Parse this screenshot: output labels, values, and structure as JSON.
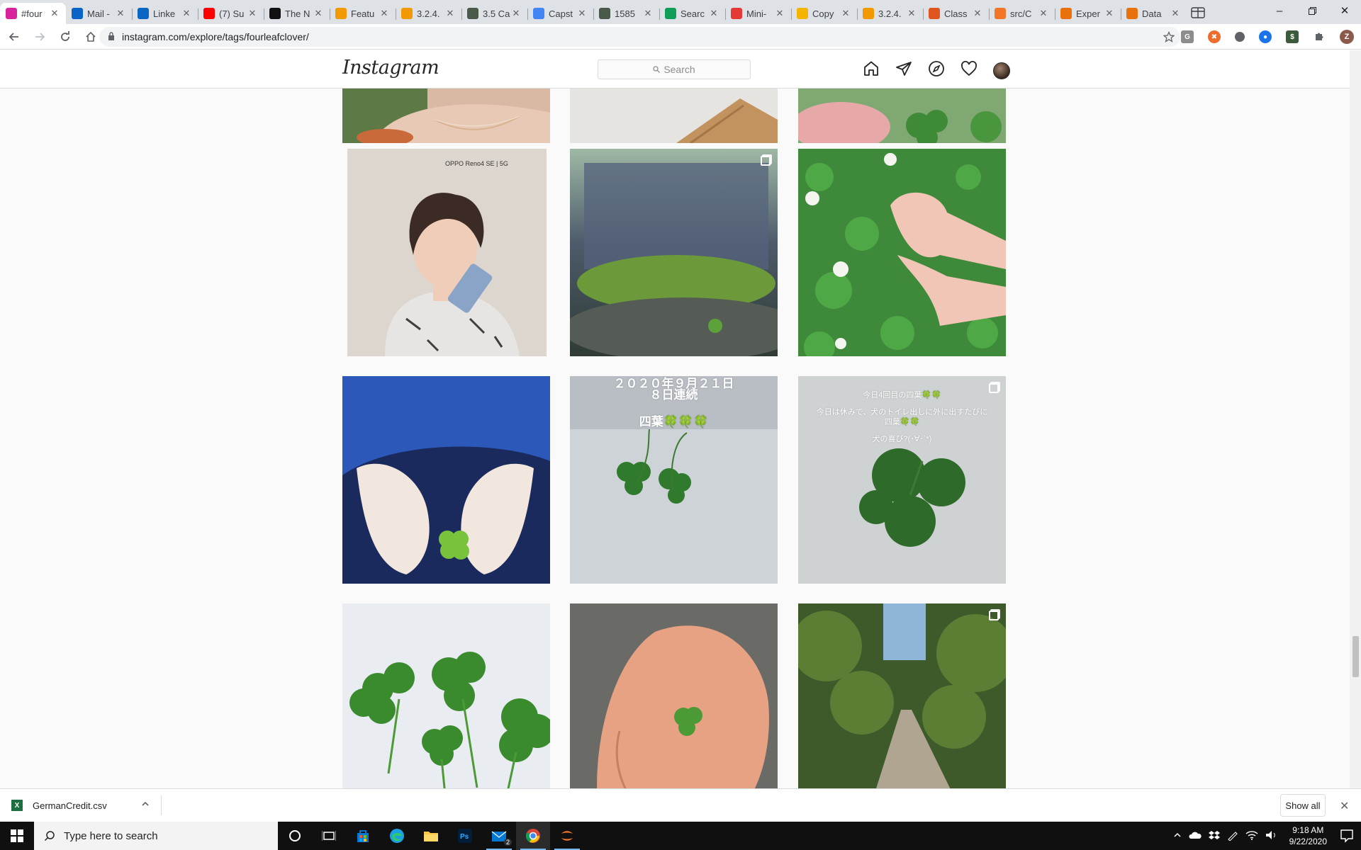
{
  "browser": {
    "tabs": [
      {
        "title": "#four",
        "icon": "instagram-icon",
        "color": "#d6249f"
      },
      {
        "title": "Mail -",
        "icon": "outlook-icon",
        "color": "#0a64c8"
      },
      {
        "title": "Linke",
        "icon": "linkedin-icon",
        "color": "#0a66c2"
      },
      {
        "title": "(7) Su",
        "icon": "youtube-icon",
        "color": "#ff0000"
      },
      {
        "title": "The N",
        "icon": "nyt-icon",
        "color": "#111111"
      },
      {
        "title": "Featu",
        "icon": "chart-icon",
        "color": "#f29900"
      },
      {
        "title": "3.2.4.",
        "icon": "chart-icon",
        "color": "#f29900"
      },
      {
        "title": "3.5 Ca",
        "icon": "doc-icon",
        "color": "#4a5a4a"
      },
      {
        "title": "Capst",
        "icon": "docs-icon",
        "color": "#4285f4"
      },
      {
        "title": "1585",
        "icon": "doc-icon",
        "color": "#4a5a4a"
      },
      {
        "title": "Searc",
        "icon": "drive-icon",
        "color": "#0f9d58"
      },
      {
        "title": "Mini-",
        "icon": "link-icon",
        "color": "#e53935"
      },
      {
        "title": "Copy",
        "icon": "copy-icon",
        "color": "#f4b400"
      },
      {
        "title": "3.2.4.",
        "icon": "chart-icon",
        "color": "#f29900"
      },
      {
        "title": "Class",
        "icon": "notebook-icon",
        "color": "#e0541d"
      },
      {
        "title": "src/C",
        "icon": "jupyter-icon",
        "color": "#f37626"
      },
      {
        "title": "Exper",
        "icon": "book-icon",
        "color": "#e8710a"
      },
      {
        "title": "Data",
        "icon": "book-icon",
        "color": "#e8710a"
      }
    ],
    "url": "instagram.com/explore/tags/fourleafclover/",
    "profile_initial": "Z"
  },
  "instagram": {
    "logo": "Instagram",
    "search_placeholder": "Search",
    "posts": [
      {
        "name": "post-bracelet-partial"
      },
      {
        "name": "post-wood-partial"
      },
      {
        "name": "post-clover-partial"
      },
      {
        "name": "post-oppo-portrait",
        "text_lines": [
          "OPPO Reno4 SE | 5G"
        ]
      },
      {
        "name": "post-mossy-rock"
      },
      {
        "name": "post-heart-hands"
      },
      {
        "name": "post-cupped-hands"
      },
      {
        "name": "post-clover-table",
        "text_lines": [
          "２０２０年９月２１日",
          "８日連続",
          "四葉🍀🍀🍀"
        ]
      },
      {
        "name": "post-clover-dog",
        "text_lines": [
          "今日4回目の四葉🍀🍀",
          "今日は休みで、犬のトイレ出しに外に出すたびに",
          "四葉🍀🍀",
          "犬の喜び?(･∀･`*)"
        ]
      },
      {
        "name": "post-pressed-clovers"
      },
      {
        "name": "post-hand-clover"
      },
      {
        "name": "post-forest-path"
      }
    ]
  },
  "downloads": {
    "file": "GermanCredit.csv",
    "show_all": "Show all"
  },
  "taskbar": {
    "search_placeholder": "Type here to search",
    "time": "9:18 AM",
    "date": "9/22/2020",
    "mail_badge": "2"
  }
}
